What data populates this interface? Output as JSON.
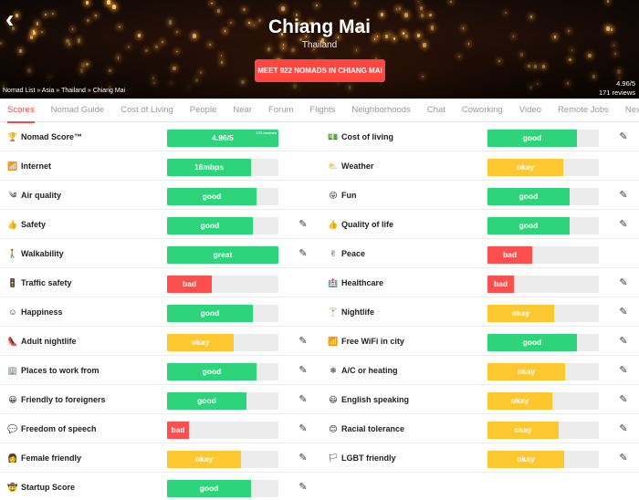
{
  "hero": {
    "back_icon": "back-arrow-icon",
    "city": "Chiang Mai",
    "country": "Thailand",
    "meet_button": "MEET 922 NOMADS IN CHIANG MAI",
    "breadcrumb": "Nomad List » Asia » Thailand » Chiang Mai",
    "rating": "4.96/5",
    "reviews": "171 reviews"
  },
  "tabs": [
    "Scores",
    "Nomad Guide",
    "Cost of Living",
    "People",
    "Near",
    "Forum",
    "Flights",
    "Neighborhoods",
    "Chat",
    "Coworking",
    "Video",
    "Remote Jobs",
    "Next"
  ],
  "active_tab": 0,
  "colors": {
    "green": "#2ed47a",
    "yellow": "#fcc72f",
    "red": "#fd4f4d",
    "accent": "#ff4742",
    "track": "#ececec"
  },
  "left_scores": [
    {
      "icon": "trophy-icon",
      "glyph": "🏆",
      "label": "Nomad Score™",
      "value": "4.96/5",
      "sub": "171 reviews",
      "level": 1.0,
      "color": "green",
      "editable": false
    },
    {
      "icon": "signal-icon",
      "glyph": "📶",
      "label": "Internet",
      "value": "16mbps",
      "level": 0.75,
      "color": "green",
      "editable": false
    },
    {
      "icon": "wind-icon",
      "glyph": "༄",
      "label": "Air quality",
      "value": "good",
      "level": 0.8,
      "color": "green",
      "editable": false
    },
    {
      "icon": "thumbs-up-icon",
      "glyph": "👍",
      "label": "Safety",
      "value": "good",
      "level": 0.77,
      "color": "green",
      "editable": true
    },
    {
      "icon": "walking-icon",
      "glyph": "🚶",
      "label": "Walkability",
      "value": "great",
      "level": 1.0,
      "color": "green",
      "editable": true
    },
    {
      "icon": "traffic-light-icon",
      "glyph": "🚦",
      "label": "Traffic safety",
      "value": "bad",
      "level": 0.4,
      "color": "red",
      "editable": false
    },
    {
      "icon": "smile-icon",
      "glyph": "☺",
      "label": "Happiness",
      "value": "good",
      "level": 0.77,
      "color": "green",
      "editable": false
    },
    {
      "icon": "shoe-icon",
      "glyph": "👠",
      "label": "Adult nightlife",
      "value": "okay",
      "level": 0.6,
      "color": "yellow",
      "editable": true
    },
    {
      "icon": "building-icon",
      "glyph": "🏢",
      "label": "Places to work from",
      "value": "good",
      "level": 0.8,
      "color": "green",
      "editable": true
    },
    {
      "icon": "grin-icon",
      "glyph": "😀",
      "label": "Friendly to foreigners",
      "value": "good",
      "level": 0.71,
      "color": "green",
      "editable": true
    },
    {
      "icon": "speech-bubble-icon",
      "glyph": "💬",
      "label": "Freedom of speech",
      "value": "bad",
      "level": 0.2,
      "color": "red",
      "editable": true
    },
    {
      "icon": "woman-icon",
      "glyph": "👩",
      "label": "Female friendly",
      "value": "okay",
      "level": 0.66,
      "color": "yellow",
      "editable": true
    },
    {
      "icon": "rocket-face-icon",
      "glyph": "🤠",
      "label": "Startup Score",
      "value": "good",
      "level": 0.75,
      "color": "green",
      "editable": true
    }
  ],
  "right_scores": [
    {
      "icon": "money-icon",
      "glyph": "💵",
      "label": "Cost of living",
      "value": "good",
      "level": 0.8,
      "color": "green",
      "editable": true
    },
    {
      "icon": "cloud-icon",
      "glyph": "⛅",
      "label": "Weather",
      "value": "okay",
      "level": 0.68,
      "color": "yellow",
      "editable": false
    },
    {
      "icon": "party-face-icon",
      "glyph": "😜",
      "label": "Fun",
      "value": "good",
      "level": 0.74,
      "color": "green",
      "editable": true
    },
    {
      "icon": "thumbs-up-icon",
      "glyph": "👍",
      "label": "Quality of life",
      "value": "good",
      "level": 0.74,
      "color": "green",
      "editable": true
    },
    {
      "icon": "peace-hand-icon",
      "glyph": "✌",
      "label": "Peace",
      "value": "bad",
      "level": 0.4,
      "color": "red",
      "editable": false
    },
    {
      "icon": "hospital-icon",
      "glyph": "🏥",
      "label": "Healthcare",
      "value": "bad",
      "level": 0.24,
      "color": "red",
      "editable": true
    },
    {
      "icon": "cocktail-icon",
      "glyph": "🍸",
      "label": "Nightlife",
      "value": "okay",
      "level": 0.6,
      "color": "yellow",
      "editable": true
    },
    {
      "icon": "wifi-icon",
      "glyph": "📶",
      "label": "Free WiFi in city",
      "value": "good",
      "level": 0.8,
      "color": "green",
      "editable": true
    },
    {
      "icon": "snowflake-icon",
      "glyph": "❄",
      "label": "A/C or heating",
      "value": "okay",
      "level": 0.7,
      "color": "yellow",
      "editable": true
    },
    {
      "icon": "face-icon",
      "glyph": "😃",
      "label": "English speaking",
      "value": "okay",
      "level": 0.58,
      "color": "yellow",
      "editable": true
    },
    {
      "icon": "smile-icon",
      "glyph": "😊",
      "label": "Racial tolerance",
      "value": "okay",
      "level": 0.64,
      "color": "yellow",
      "editable": true
    },
    {
      "icon": "rainbow-icon",
      "glyph": "🏳",
      "label": "LGBT friendly",
      "value": "okay",
      "level": 0.69,
      "color": "yellow",
      "editable": true
    }
  ]
}
